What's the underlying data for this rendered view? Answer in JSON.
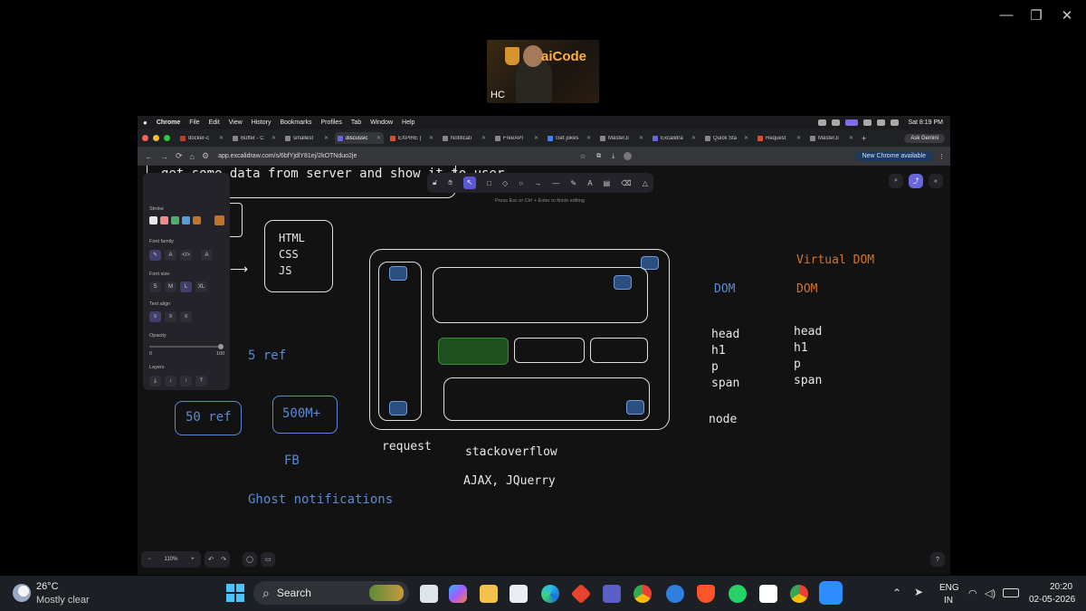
{
  "window_controls": {
    "minimize": "—",
    "restore": "❐",
    "close": "✕"
  },
  "video": {
    "logo_text": "aiCode",
    "initials": "HC"
  },
  "menubar": {
    "items": [
      "Chrome",
      "File",
      "Edit",
      "View",
      "History",
      "Bookmarks",
      "Profiles",
      "Tab",
      "Window",
      "Help"
    ],
    "clock": "Sat 8:19 PM"
  },
  "tabs": [
    {
      "label": "docker-c"
    },
    {
      "label": "Buffer - C"
    },
    {
      "label": "smallest"
    },
    {
      "label": "discussic",
      "active": true
    },
    {
      "label": "EXPIRE |"
    },
    {
      "label": "Notificati"
    },
    {
      "label": "FreeAPI"
    },
    {
      "label": "Get jokes"
    },
    {
      "label": "MasterJi"
    },
    {
      "label": "Excalidra"
    },
    {
      "label": "Quick Sta"
    },
    {
      "label": "Request"
    },
    {
      "label": "MasterJi"
    }
  ],
  "new_tab": "+",
  "ask_gemini": "Ask Gemini",
  "address": {
    "url": "app.excalidraw.com/s/6bfYjdlY81ej/2kOTNduo2je",
    "update_badge": "New Chrome available"
  },
  "excalidraw": {
    "scene_name": "discussions",
    "hint": "Press Esc or Ctrl + Enter to finish editing",
    "props": {
      "stroke_label": "Stroke",
      "font_family_label": "Font family",
      "font_size_label": "Font size",
      "font_sizes": [
        "S",
        "M",
        "L",
        "XL"
      ],
      "text_align_label": "Text align",
      "opacity_label": "Opacity",
      "opacity_min": "0",
      "opacity_max": "100",
      "layers_label": "Layers"
    },
    "zoom": "110%",
    "stroke_colors": [
      "#e8e8e8",
      "#f08c8c",
      "#4caf6a",
      "#5b9bd5",
      "#c0732a"
    ],
    "selected_color": "#c0732a"
  },
  "drawing": {
    "top_text": "get some data from server and show it to user",
    "stack": [
      "HTML",
      "CSS",
      "JS"
    ],
    "ref5": "5 ref",
    "ref50": "50 ref",
    "m500": "500M+",
    "fb": "FB",
    "ghost": "Ghost notifications",
    "request": "request",
    "stackoverflow": "stackoverflow",
    "ajax": "AJAX, JQuerry",
    "dom_heading": "DOM",
    "virtual_dom_heading": "Virtual DOM",
    "vdom_dom": "DOM",
    "dom_list": [
      "head",
      "h1",
      "p",
      "span"
    ],
    "vdom_list": [
      "head",
      "h1",
      "p",
      "span"
    ],
    "node": "node"
  },
  "taskbar": {
    "weather_temp": "26°C",
    "weather_desc": "Mostly clear",
    "search": "Search",
    "lang_top": "ENG",
    "lang_bottom": "IN",
    "time": "20:20",
    "date": "02-05-2026"
  }
}
